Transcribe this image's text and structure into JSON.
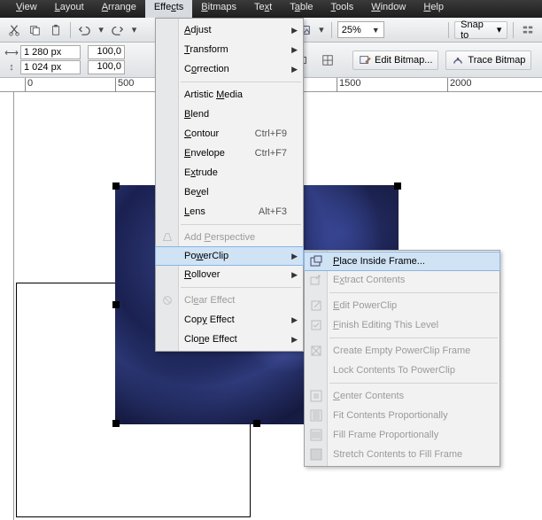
{
  "menubar": {
    "items": [
      "View",
      "Layout",
      "Arrange",
      "Effects",
      "Bitmaps",
      "Text",
      "Table",
      "Tools",
      "Window",
      "Help"
    ],
    "active_index": 3
  },
  "toolbar": {
    "zoom": "25%",
    "snap_label": "Snap to"
  },
  "propbar": {
    "width_val": "1 280 px",
    "height_val": "1 024 px",
    "scale_x": "100,0",
    "scale_y": "100,0",
    "edit_bitmap": "Edit Bitmap...",
    "trace_bitmap": "Trace Bitmap"
  },
  "ruler": {
    "ticks": [
      "0",
      "500",
      "1500",
      "2000"
    ]
  },
  "effects_menu": {
    "adjust": "Adjust",
    "transform": "Transform",
    "correction": "Correction",
    "artistic": "Artistic Media",
    "blend": "Blend",
    "contour": "Contour",
    "contour_sc": "Ctrl+F9",
    "envelope": "Envelope",
    "envelope_sc": "Ctrl+F7",
    "extrude": "Extrude",
    "bevel": "Bevel",
    "lens": "Lens",
    "lens_sc": "Alt+F3",
    "add_perspective": "Add Perspective",
    "powerclip": "PowerClip",
    "rollover": "Rollover",
    "clear_effect": "Clear Effect",
    "copy_effect": "Copy Effect",
    "clone_effect": "Clone Effect"
  },
  "powerclip_menu": {
    "place_inside": "Place Inside Frame...",
    "extract": "Extract Contents",
    "edit_pc": "Edit PowerClip",
    "finish": "Finish Editing This Level",
    "create_empty": "Create Empty PowerClip Frame",
    "lock": "Lock Contents To PowerClip",
    "center": "Center Contents",
    "fit_prop": "Fit Contents Proportionally",
    "fill_prop": "Fill Frame Proportionally",
    "stretch": "Stretch Contents to Fill Frame"
  }
}
